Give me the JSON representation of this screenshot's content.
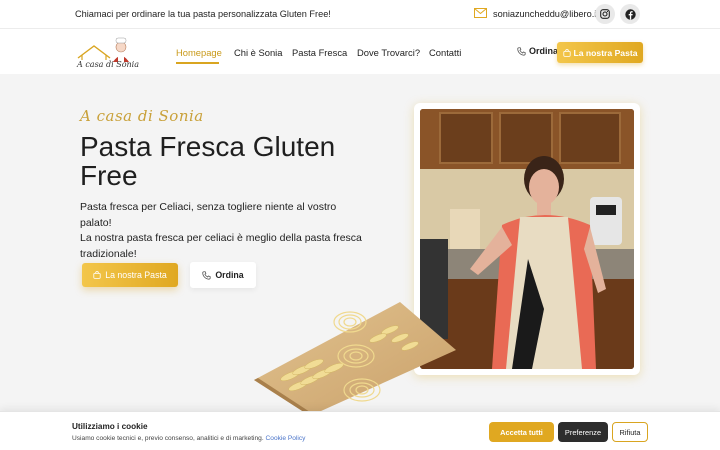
{
  "topbar": {
    "promo_text": "Chiamaci per ordinare la tua pasta personalizzata Gluten Free!",
    "email": "soniazuncheddu@libero.it",
    "icons": [
      "mail-icon",
      "instagram-icon",
      "facebook-icon"
    ]
  },
  "nav": {
    "logo_text": "A casa di Sonia",
    "items": [
      {
        "label": "Homepage",
        "active": true
      },
      {
        "label": "Chi è Sonia",
        "active": false
      },
      {
        "label": "Pasta Fresca",
        "active": false
      },
      {
        "label": "Dove Trovarci?",
        "active": false
      },
      {
        "label": "Contatti",
        "active": false
      }
    ],
    "ordina_label": "Ordina",
    "cta_label": "La nostra Pasta"
  },
  "hero": {
    "script_title": "A casa di Sonia",
    "title": "Pasta Fresca Gluten Free",
    "description_line1": "Pasta fresca per Celiaci, senza togliere niente al vostro palato!",
    "description_line2": "La nostra pasta fresca per celiaci è meglio della pasta fresca tradizionale!",
    "cta_label": "La nostra Pasta",
    "ordina_label": "Ordina"
  },
  "cookie": {
    "title": "Utilizziamo i cookie",
    "text": "Usiamo cookie tecnici e, previo consenso, analitici e di marketing.",
    "link_text": "Cookie Policy",
    "accept_label": "Accetta tutti",
    "preferences_label": "Preferenze",
    "reject_label": "Rifiuta"
  },
  "colors": {
    "accent": "#e0a821",
    "accent_light": "#f3c64a",
    "background": "#f4f4f4",
    "dark_button": "#2d2d2d",
    "link": "#4a74c9"
  }
}
